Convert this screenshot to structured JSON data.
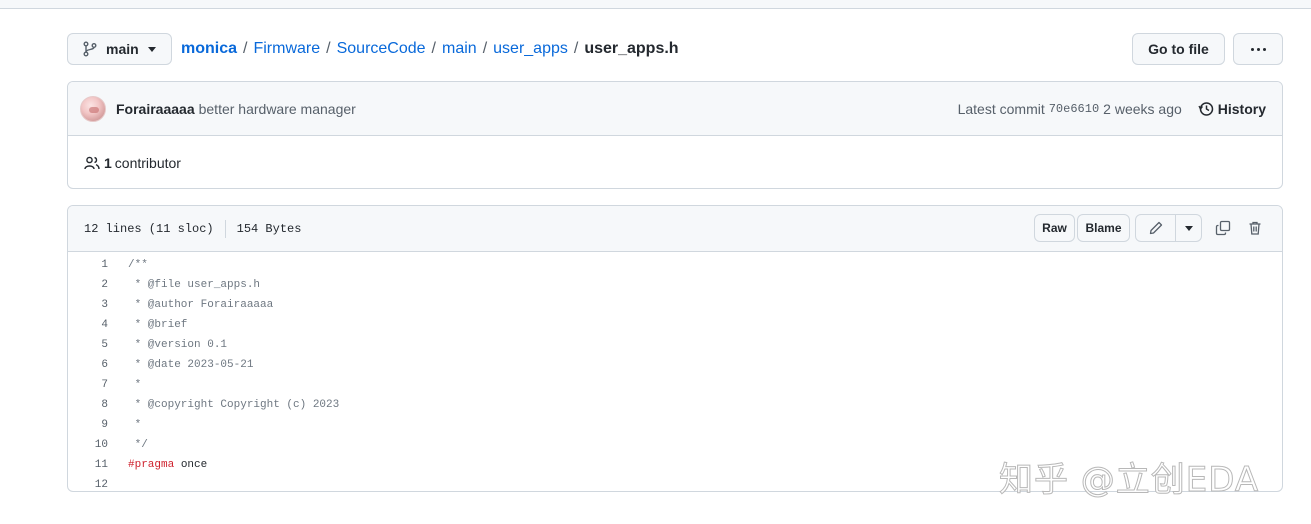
{
  "branch": {
    "name": "main"
  },
  "breadcrumb": {
    "repo": "monica",
    "parts": [
      "Firmware",
      "SourceCode",
      "main",
      "user_apps"
    ],
    "current": "user_apps.h"
  },
  "actions": {
    "goto_file": "Go to file"
  },
  "commit": {
    "author": "Forairaaaaa",
    "message": "better hardware manager",
    "latest_label": "Latest commit",
    "sha": "70e6610",
    "time": "2 weeks ago",
    "history_label": "History"
  },
  "contributors": {
    "count": "1",
    "label": "contributor"
  },
  "file": {
    "lines_info": "12 lines (11 sloc)",
    "size": "154 Bytes",
    "raw_label": "Raw",
    "blame_label": "Blame"
  },
  "code": {
    "lines": [
      {
        "n": "1",
        "text": "/**"
      },
      {
        "n": "2",
        "text": " * @file user_apps.h"
      },
      {
        "n": "3",
        "text": " * @author Forairaaaaa"
      },
      {
        "n": "4",
        "text": " * @brief"
      },
      {
        "n": "5",
        "text": " * @version 0.1"
      },
      {
        "n": "6",
        "text": " * @date 2023-05-21"
      },
      {
        "n": "7",
        "text": " *"
      },
      {
        "n": "8",
        "text": " * @copyright Copyright (c) 2023"
      },
      {
        "n": "9",
        "text": " *"
      },
      {
        "n": "10",
        "text": " */"
      },
      {
        "n": "11",
        "directive": "#pragma",
        "text": " once"
      },
      {
        "n": "12",
        "text": ""
      }
    ]
  },
  "watermark": "知乎 @立创EDA",
  "icons": {
    "branch": "git-branch-icon",
    "more": "kebab-horizontal-icon",
    "history": "history-clock-icon",
    "contributors": "people-icon",
    "edit": "pencil-icon",
    "copy": "copy-icon",
    "delete": "trash-icon"
  },
  "colors": {
    "link": "#0969da",
    "border": "#d0d7de",
    "header_bg": "#f6f8fa",
    "keyword": "#cf222e"
  }
}
